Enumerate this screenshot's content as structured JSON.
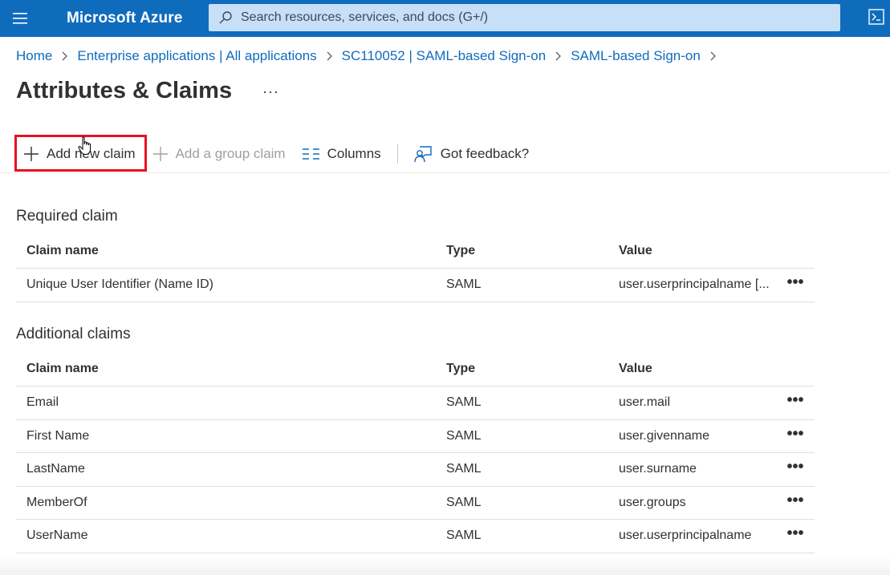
{
  "app": {
    "brand": "Microsoft Azure"
  },
  "search": {
    "placeholder": "Search resources, services, and docs (G+/)"
  },
  "breadcrumb": [
    "Home",
    "Enterprise applications | All applications",
    "SC110052 | SAML-based Sign-on",
    "SAML-based Sign-on"
  ],
  "page": {
    "title": "Attributes & Claims",
    "more": "···"
  },
  "toolbar": {
    "add_new_claim": "Add new claim",
    "add_group_claim": "Add a group claim",
    "columns": "Columns",
    "feedback": "Got feedback?"
  },
  "required": {
    "section_title": "Required claim",
    "headers": {
      "name": "Claim name",
      "type": "Type",
      "value": "Value"
    },
    "rows": [
      {
        "name": "Unique User Identifier (Name ID)",
        "type": "SAML",
        "value": "user.userprincipalname [..."
      }
    ]
  },
  "additional": {
    "section_title": "Additional claims",
    "headers": {
      "name": "Claim name",
      "type": "Type",
      "value": "Value"
    },
    "rows": [
      {
        "name": "Email",
        "type": "SAML",
        "value": "user.mail"
      },
      {
        "name": "First Name",
        "type": "SAML",
        "value": "user.givenname"
      },
      {
        "name": "LastName",
        "type": "SAML",
        "value": "user.surname"
      },
      {
        "name": "MemberOf",
        "type": "SAML",
        "value": "user.groups"
      },
      {
        "name": "UserName",
        "type": "SAML",
        "value": "user.userprincipalname"
      }
    ]
  },
  "row_more": "•••",
  "colors": {
    "accent": "#0f6cbd",
    "highlight": "#e81123"
  }
}
